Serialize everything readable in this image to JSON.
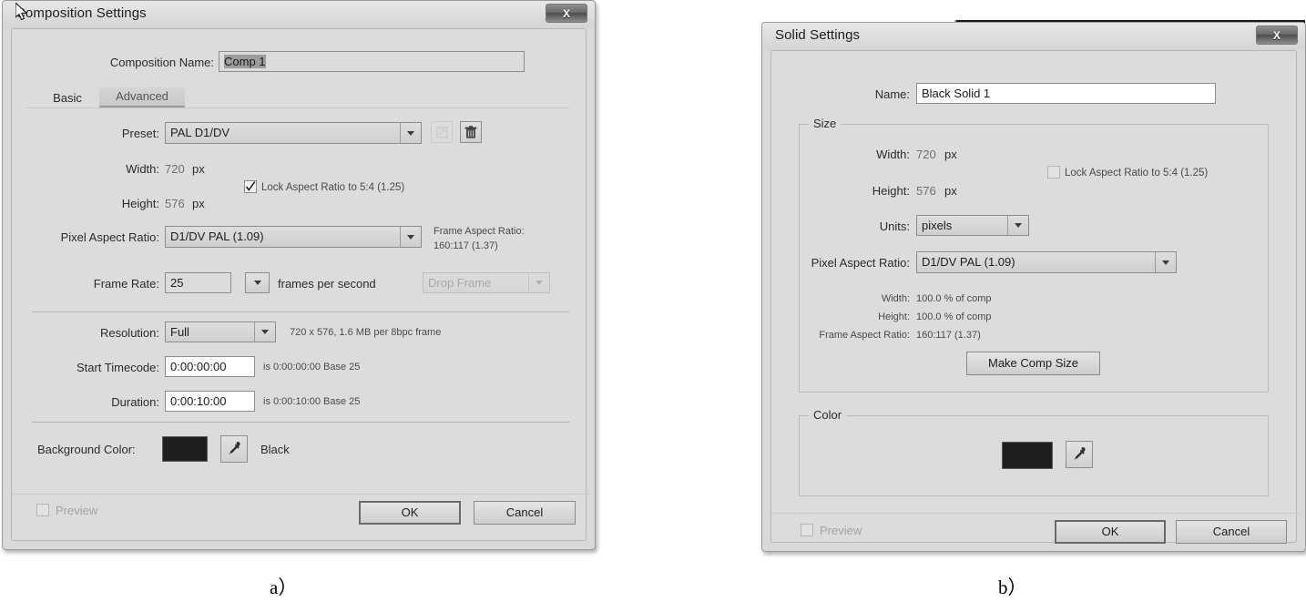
{
  "figure": {
    "caption_a": "a）",
    "caption_b": "b）"
  },
  "comp_dialog": {
    "title": "Composition Settings",
    "close_label": "X",
    "name_label": "Composition Name:",
    "name_value": "Comp 1",
    "tabs": [
      {
        "label": "Basic",
        "active": true
      },
      {
        "label": "Advanced",
        "active": false
      }
    ],
    "preset_label": "Preset:",
    "preset_value": "PAL D1/DV",
    "preset_save_icon": "save-preset-icon",
    "preset_delete_icon": "trash-icon",
    "width_label": "Width:",
    "width_value": "720",
    "width_unit": "px",
    "height_label": "Height:",
    "height_value": "576",
    "height_unit": "px",
    "lock_aspect_label": "Lock Aspect Ratio to 5:4 (1.25)",
    "lock_aspect_checked": true,
    "par_label": "Pixel Aspect Ratio:",
    "par_value": "D1/DV PAL (1.09)",
    "far_label": "Frame Aspect Ratio:",
    "far_value": "160:117 (1.37)",
    "frame_rate_label": "Frame Rate:",
    "frame_rate_value": "25",
    "fps_label": "frames per second",
    "drop_frame_value": "Drop Frame",
    "resolution_label": "Resolution:",
    "resolution_value": "Full",
    "resolution_info": "720 x 576, 1.6 MB per 8bpc frame",
    "start_timecode_label": "Start Timecode:",
    "start_timecode_value": "0:00:00:00",
    "start_timecode_info": "is 0:00:00:00  Base 25",
    "duration_label": "Duration:",
    "duration_value": "0:00:10:00",
    "duration_info": "is 0:00:10:00  Base 25",
    "background_color_label": "Background Color:",
    "background_color_hex": "#1f1f1f",
    "background_color_name": "Black",
    "eyedropper_icon": "eyedropper-icon",
    "preview_label": "Preview",
    "preview_checked": false,
    "ok_label": "OK",
    "cancel_label": "Cancel"
  },
  "solid_dialog": {
    "title": "Solid Settings",
    "close_label": "X",
    "name_label": "Name:",
    "name_value": "Black Solid 1",
    "size_group_label": "Size",
    "width_label": "Width:",
    "width_value": "720",
    "width_unit": "px",
    "height_label": "Height:",
    "height_value": "576",
    "height_unit": "px",
    "lock_aspect_label": "Lock Aspect Ratio to 5:4 (1.25)",
    "lock_aspect_checked": false,
    "units_label": "Units:",
    "units_value": "pixels",
    "par_label": "Pixel Aspect Ratio:",
    "par_value": "D1/DV PAL (1.09)",
    "pct_width_label": "Width:",
    "pct_width_value": "100.0 % of comp",
    "pct_height_label": "Height:",
    "pct_height_value": "100.0 % of comp",
    "far_label": "Frame Aspect Ratio:",
    "far_value": "160:117 (1.37)",
    "make_comp_size_label": "Make Comp Size",
    "color_group_label": "Color",
    "color_hex": "#1f1f1f",
    "eyedropper_icon": "eyedropper-icon",
    "preview_label": "Preview",
    "preview_checked": false,
    "ok_label": "OK",
    "cancel_label": "Cancel"
  }
}
